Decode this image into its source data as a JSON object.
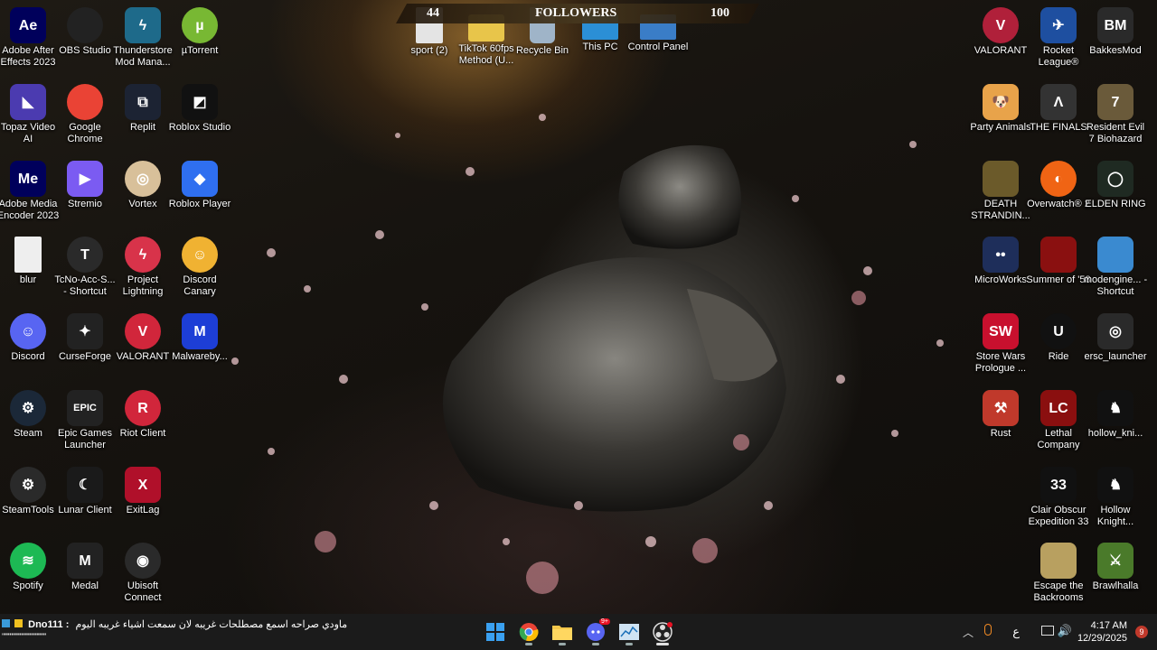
{
  "banner": {
    "left_count": "44",
    "title": "FOLLOWERS",
    "right_count": "100"
  },
  "desktop_icons": [
    {
      "label": "Adobe After Effects 2023",
      "icon": "after-effects-icon",
      "color": "#00005b",
      "text": "Ae"
    },
    {
      "label": "OBS Studio",
      "icon": "obs-icon",
      "color": "#222",
      "text": ""
    },
    {
      "label": "Thunderstore Mod Mana...",
      "icon": "thunderstore-icon",
      "color": "#1e6a8a",
      "text": "ϟ"
    },
    {
      "label": "µTorrent",
      "icon": "utorrent-icon",
      "color": "#78b833",
      "text": "µ"
    },
    {
      "label": "sport (2)",
      "icon": "sport-icon",
      "color": "#e4e4e4",
      "text": ""
    },
    {
      "label": "TikTok 60fps Method (U...",
      "icon": "folder-icon",
      "color": "#e8c54a",
      "text": ""
    },
    {
      "label": "Recycle Bin",
      "icon": "recycle-bin-icon",
      "color": "#9fb4c8",
      "text": ""
    },
    {
      "label": "This PC",
      "icon": "this-pc-icon",
      "color": "#2b8fd6",
      "text": ""
    },
    {
      "label": "Control Panel",
      "icon": "control-panel-icon",
      "color": "#3a7dc7",
      "text": ""
    },
    {
      "label": "Topaz Video AI",
      "icon": "topaz-icon",
      "color": "#4b3bb0",
      "text": "◣"
    },
    {
      "label": "Google Chrome",
      "icon": "chrome-icon",
      "color": "#ea4335",
      "text": ""
    },
    {
      "label": "Replit",
      "icon": "replit-icon",
      "color": "#1c2333",
      "text": "⧉"
    },
    {
      "label": "Roblox Studio",
      "icon": "roblox-studio-icon",
      "color": "#111",
      "text": "◩"
    },
    {
      "label": "Adobe Media Encoder 2023",
      "icon": "media-encoder-icon",
      "color": "#00005b",
      "text": "Me"
    },
    {
      "label": "Stremio",
      "icon": "stremio-icon",
      "color": "#7b5bf2",
      "text": "▶"
    },
    {
      "label": "Vortex",
      "icon": "vortex-icon",
      "color": "#d8c09a",
      "text": "◎"
    },
    {
      "label": "Roblox Player",
      "icon": "roblox-player-icon",
      "color": "#2f6ff0",
      "text": "◆"
    },
    {
      "label": "blur",
      "icon": "blur-icon",
      "color": "#eee",
      "text": ""
    },
    {
      "label": "TcNo-Acc-S... - Shortcut",
      "icon": "tcno-icon",
      "color": "#2a2a2a",
      "text": "T"
    },
    {
      "label": "Project Lightning",
      "icon": "project-lightning-icon",
      "color": "#d8334a",
      "text": "ϟ"
    },
    {
      "label": "Discord Canary",
      "icon": "discord-canary-icon",
      "color": "#f0b232",
      "text": "☺"
    },
    {
      "label": "Discord",
      "icon": "discord-icon",
      "color": "#5865f2",
      "text": "☺"
    },
    {
      "label": "CurseForge",
      "icon": "curseforge-icon",
      "color": "#222",
      "text": "✦"
    },
    {
      "label": "VALORANT",
      "icon": "valorant-icon",
      "color": "#d1263b",
      "text": "V"
    },
    {
      "label": "Malwareby...",
      "icon": "malwarebytes-icon",
      "color": "#1d3ed6",
      "text": "M"
    },
    {
      "label": "Steam",
      "icon": "steam-icon",
      "color": "#1b2838",
      "text": "⚙"
    },
    {
      "label": "Epic Games Launcher",
      "icon": "epic-games-icon",
      "color": "#222",
      "text": "EPIC"
    },
    {
      "label": "Riot Client",
      "icon": "riot-client-icon",
      "color": "#d1263b",
      "text": "R"
    },
    {
      "label": "SteamTools",
      "icon": "steamtools-icon",
      "color": "#2a2a2a",
      "text": "⚙"
    },
    {
      "label": "Lunar Client",
      "icon": "lunar-client-icon",
      "color": "#1a1a1a",
      "text": "☾"
    },
    {
      "label": "ExitLag",
      "icon": "exitlag-icon",
      "color": "#b0102a",
      "text": "X"
    },
    {
      "label": "Spotify",
      "icon": "spotify-icon",
      "color": "#1db954",
      "text": "≋"
    },
    {
      "label": "Medal",
      "icon": "medal-icon",
      "color": "#222",
      "text": "M"
    },
    {
      "label": "Ubisoft Connect",
      "icon": "ubisoft-icon",
      "color": "#2a2a2a",
      "text": "◉"
    },
    {
      "label": "VALORANT",
      "icon": "valorant-icon",
      "color": "#b0203a",
      "text": "V"
    },
    {
      "label": "Rocket League®",
      "icon": "rocket-league-icon",
      "color": "#1e4fa0",
      "text": "✈"
    },
    {
      "label": "BakkesMod",
      "icon": "bakkesmod-icon",
      "color": "#2a2a2a",
      "text": "BM"
    },
    {
      "label": "Party Animals",
      "icon": "party-animals-icon",
      "color": "#e8a34a",
      "text": "🐶"
    },
    {
      "label": "THE FINALS",
      "icon": "the-finals-icon",
      "color": "#333",
      "text": "Λ"
    },
    {
      "label": "Resident Evil 7 Biohazard",
      "icon": "resident-evil-icon",
      "color": "#6a5a3a",
      "text": "7"
    },
    {
      "label": "DEATH STRANDIN...",
      "icon": "death-stranding-icon",
      "color": "#6b5a2a",
      "text": ""
    },
    {
      "label": "Overwatch® 2",
      "icon": "overwatch-icon",
      "color": "#f06414",
      "text": "◐"
    },
    {
      "label": "ELDEN RING",
      "icon": "elden-ring-icon",
      "color": "#1f2a22",
      "text": "◯"
    },
    {
      "label": "MicroWorks",
      "icon": "microworks-icon",
      "color": "#1e2e5a",
      "text": "••"
    },
    {
      "label": "Summer of '58",
      "icon": "summer-58-icon",
      "color": "#8a1010",
      "text": ""
    },
    {
      "label": "modengine... - Shortcut",
      "icon": "modengine-icon",
      "color": "#3a8ad0",
      "text": ""
    },
    {
      "label": "Store Wars Prologue ...",
      "icon": "store-wars-icon",
      "color": "#c8102e",
      "text": "SW"
    },
    {
      "label": "Ride",
      "icon": "unreal-icon",
      "color": "#111",
      "text": "U"
    },
    {
      "label": "ersc_launcher",
      "icon": "ersc-launcher-icon",
      "color": "#2a2a2a",
      "text": "◎"
    },
    {
      "label": "Rust",
      "icon": "rust-icon",
      "color": "#c0392b",
      "text": "⚒"
    },
    {
      "label": "Lethal Company",
      "icon": "lethal-company-icon",
      "color": "#8a0f0f",
      "text": "LC"
    },
    {
      "label": "hollow_kni...",
      "icon": "hollow-knight-icon",
      "color": "#111",
      "text": "♞"
    },
    {
      "label": "Clair Obscur Expedition 33",
      "icon": "clair-obscur-icon",
      "color": "#111",
      "text": "33"
    },
    {
      "label": "Hollow Knight...",
      "icon": "hollow-knight-icon",
      "color": "#111",
      "text": "♞"
    },
    {
      "label": "Escape the Backrooms",
      "icon": "escape-backrooms-icon",
      "color": "#b8a060",
      "text": ""
    },
    {
      "label": "Brawlhalla",
      "icon": "brawlhalla-icon",
      "color": "#4a7a2a",
      "text": "⚔"
    }
  ],
  "taskbar": {
    "news_user": "Dno111 :",
    "news_text": "ماودي صراحه اسمع مصطلحات غريبه لان سمعت اشياء غريبه اليوم",
    "news_line2": "\"\"\"\"\"\"\"\"\"\"\"\"\"\"\"\"\"\"\"\"\"\"",
    "apps": [
      {
        "name": "start-button",
        "icon": "windows-icon"
      },
      {
        "name": "chrome",
        "icon": "chrome-icon"
      },
      {
        "name": "file-explorer",
        "icon": "folder-icon"
      },
      {
        "name": "discord",
        "icon": "discord-icon",
        "badge": "9+"
      },
      {
        "name": "task-manager",
        "icon": "chart-icon"
      },
      {
        "name": "obs",
        "icon": "obs-icon"
      }
    ],
    "tray": {
      "lang": "ع",
      "time": "4:17 AM",
      "date": "12/29/2025",
      "notification_count": "9"
    }
  },
  "colors": {
    "taskbar_bg": "#1b1b1b",
    "accent": "#0078d4"
  }
}
